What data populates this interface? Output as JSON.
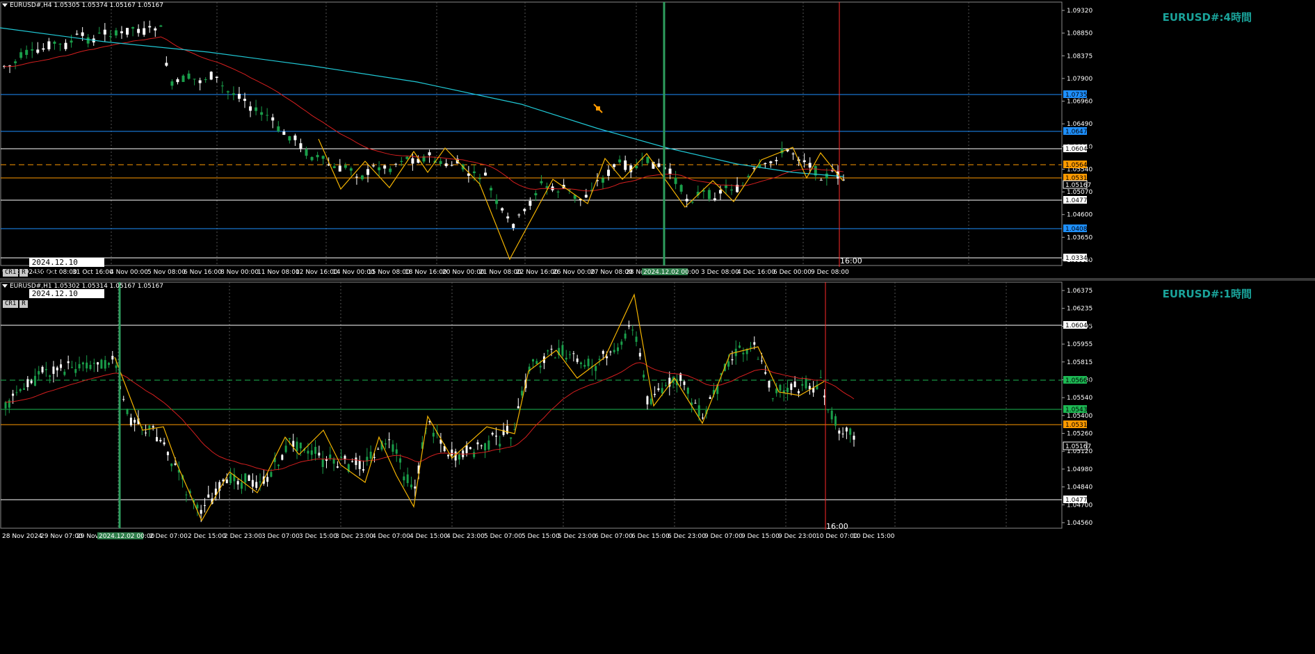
{
  "top_pane": {
    "header": "EURUSD#,H4  1.05305 1.05374 1.05167 1.05167",
    "watermark": "EURUSD#:4時間",
    "crosshair_buttons": [
      "CR1",
      "R"
    ],
    "crosshair_datetime": "2024.12.10  16:00",
    "vline_label": "16:00",
    "green_vline_label": "2024.12.02 00:00",
    "price_axis": [
      "1.09320",
      "1.08850",
      "1.08375",
      "1.07900",
      "1.06960",
      "1.06490",
      "1.06010",
      "1.05540",
      "1.05070",
      "1.04600",
      "1.03650",
      "1.03180"
    ],
    "price_levels": [
      {
        "label": "1.07351",
        "color": "#1e90ff",
        "style": "solid"
      },
      {
        "label": "1.06472",
        "color": "#1e90ff",
        "style": "solid"
      },
      {
        "label": "1.06049",
        "color": "#ffffff",
        "style": "solid"
      },
      {
        "label": "1.05647",
        "color": "#ff9a00",
        "style": "dashed"
      },
      {
        "label": "1.05319",
        "color": "#ff9a00",
        "style": "solid"
      },
      {
        "label": "1.05167",
        "color": "#ffffff",
        "style": "current"
      },
      {
        "label": "1.04773",
        "color": "#ffffff",
        "style": "solid"
      },
      {
        "label": "1.04084",
        "color": "#1e90ff",
        "style": "solid"
      },
      {
        "label": "1.03344",
        "color": "#ffffff",
        "style": "solid"
      }
    ],
    "time_axis": [
      "9 Oct 2024",
      "30 Oct 08:00",
      "31 Oct 16:00",
      "4 Nov 00:00",
      "5 Nov 08:00",
      "6 Nov 16:00",
      "8 Nov 00:00",
      "11 Nov 08:00",
      "12 Nov 16:00",
      "14 Nov 00:00",
      "15 Nov 08:00",
      "18 Nov 16:00",
      "20 Nov 00:00",
      "21 Nov 08:00",
      "22 Nov 16:00",
      "26 Nov 00:00",
      "27 Nov 08:00",
      "28 No",
      "3 Dec 08:00",
      "4 Dec 16:00",
      "6 Dec 00:00",
      "9 Dec 08:00"
    ]
  },
  "bottom_pane": {
    "header": "EURUSD#,H1  1.05302 1.05314 1.05167 1.05167",
    "watermark": "EURUSD#:1時間",
    "crosshair_buttons": [
      "CR1",
      "R"
    ],
    "crosshair_datetime": "2024.12.10  14:00",
    "vline_label": "16:00",
    "green_vline_label": "2024.12.02 00:00",
    "price_axis": [
      "1.06375",
      "1.06235",
      "1.06095",
      "1.05955",
      "1.05815",
      "1.05680",
      "1.05540",
      "1.05400",
      "1.05260",
      "1.05120",
      "1.04980",
      "1.04840",
      "1.04700",
      "1.04560"
    ],
    "price_levels": [
      {
        "label": "1.06049",
        "color": "#ffffff",
        "style": "solid"
      },
      {
        "label": "1.05668",
        "color": "#1db954",
        "style": "dashed"
      },
      {
        "label": "1.05437",
        "color": "#1db954",
        "style": "solid"
      },
      {
        "label": "1.05319",
        "color": "#ff9a00",
        "style": "solid"
      },
      {
        "label": "1.05167",
        "color": "#ffffff",
        "style": "current"
      },
      {
        "label": "1.04773",
        "color": "#ffffff",
        "style": "solid"
      }
    ],
    "time_axis": [
      "28 Nov 2024",
      "29 Nov 07:00",
      "29 Nov",
      "2 Dec 07:00",
      "2 Dec 15:00",
      "2 Dec 23:00",
      "3 Dec 07:00",
      "3 Dec 15:00",
      "3 Dec 23:00",
      "4 Dec 07:00",
      "4 Dec 15:00",
      "4 Dec 23:00",
      "5 Dec 07:00",
      "5 Dec 15:00",
      "5 Dec 23:00",
      "6 Dec 07:00",
      "6 Dec 15:00",
      "6 Dec 23:00",
      "9 Dec 07:00",
      "9 Dec 15:00",
      "9 Dec 23:00",
      "10 Dec 07:00",
      "10 Dec 15:00"
    ]
  },
  "colors": {
    "bull_candle": "#1a9e4a",
    "bear_candle": "#ffffff",
    "ma_fast": "#d71f1f",
    "ma_slow": "#20c9d6",
    "zigzag": "#f5b400",
    "green_vline": "#2e9e5e",
    "red_vline": "#ff2a2a",
    "grid": "#555555"
  }
}
